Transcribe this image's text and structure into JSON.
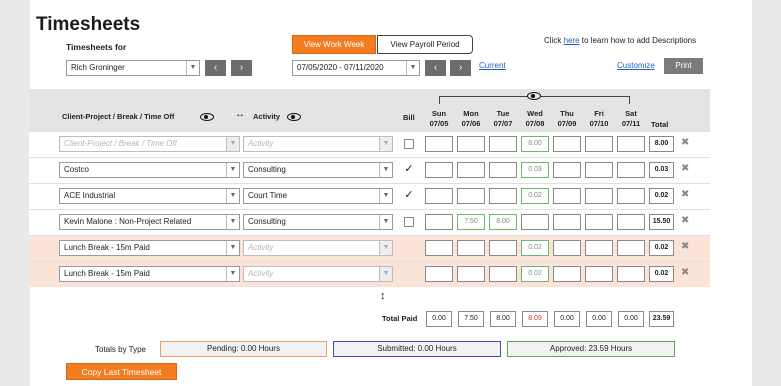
{
  "page_title": "Timesheets",
  "timesheets_for_label": "Timesheets for",
  "employee_select": "Rich Groninger",
  "view_work_week": "View Work Week",
  "view_payroll_period": "View Payroll Period",
  "date_range": "07/05/2020 - 07/11/2020",
  "current_link": "Current",
  "help_prefix": "Click ",
  "help_link": "here",
  "help_suffix": " to learn how to add Descriptions",
  "customize_link": "Customize",
  "print_button": "Print",
  "columns": {
    "client": "Client-Project / Break / Time Off",
    "activity": "Activity",
    "bill": "Bill",
    "total": "Total"
  },
  "days": [
    {
      "name": "Sun",
      "date": "07/05"
    },
    {
      "name": "Mon",
      "date": "07/06"
    },
    {
      "name": "Tue",
      "date": "07/07"
    },
    {
      "name": "Wed",
      "date": "07/08"
    },
    {
      "name": "Thu",
      "date": "07/09"
    },
    {
      "name": "Fri",
      "date": "07/10"
    },
    {
      "name": "Sat",
      "date": "07/11"
    }
  ],
  "rows": [
    {
      "client": "Client-Project / Break / Time Off",
      "client_placeholder": true,
      "activity": "Activity",
      "activity_placeholder": true,
      "bill": false,
      "cells": [
        "",
        "",
        "",
        "8.00",
        "",
        "",
        ""
      ],
      "total": "8.00",
      "break": false
    },
    {
      "client": "Costco",
      "client_placeholder": false,
      "activity": "Consulting",
      "activity_placeholder": false,
      "bill": true,
      "cells": [
        "",
        "",
        "",
        "0.03",
        "",
        "",
        ""
      ],
      "total": "0.03",
      "break": false
    },
    {
      "client": "ACE Industrial",
      "client_placeholder": false,
      "activity": "Court Time",
      "activity_placeholder": false,
      "bill": true,
      "cells": [
        "",
        "",
        "",
        "0.02",
        "",
        "",
        ""
      ],
      "total": "0.02",
      "break": false
    },
    {
      "client": "Kevin Malone : Non-Project Related",
      "client_placeholder": false,
      "activity": "Consulting",
      "activity_placeholder": false,
      "bill": false,
      "cells": [
        "",
        "7.50",
        "8.00",
        "",
        "",
        "",
        ""
      ],
      "total": "15.50",
      "break": false
    },
    {
      "client": "Lunch Break - 15m Paid",
      "client_placeholder": false,
      "activity": "Activity",
      "activity_placeholder": true,
      "bill": null,
      "cells": [
        "",
        "",
        "",
        "0.02",
        "",
        "",
        ""
      ],
      "total": "0.02",
      "break": true
    },
    {
      "client": "Lunch Break - 15m Paid",
      "client_placeholder": false,
      "activity": "Activity",
      "activity_placeholder": true,
      "bill": null,
      "cells": [
        "",
        "",
        "",
        "0.02",
        "",
        "",
        ""
      ],
      "total": "0.02",
      "break": true
    }
  ],
  "total_paid_label": "Total Paid",
  "total_paid": [
    "0.00",
    "7.50",
    "8.00",
    "8.09",
    "0.00",
    "0.00",
    "0.00"
  ],
  "total_paid_sum": "23.59",
  "totals_by_type_label": "Totals by Type",
  "pending": "Pending: 0.00 Hours",
  "submitted": "Submitted: 0.00 Hours",
  "approved": "Approved: 23.59 Hours",
  "copy_last": "Copy Last Timesheet",
  "colors": {
    "accent": "#f47c20",
    "pending_border": "#f0a060",
    "submitted_border": "#4a4ab8",
    "approved_border": "#5aa85a",
    "total_red": "#d9342b"
  },
  "icons": [
    "eye-icon",
    "resize-horizontal-icon",
    "resize-vertical-icon",
    "delete-icon",
    "chevron-left-icon",
    "chevron-right-icon",
    "chevron-down-icon",
    "checkmark-icon"
  ]
}
